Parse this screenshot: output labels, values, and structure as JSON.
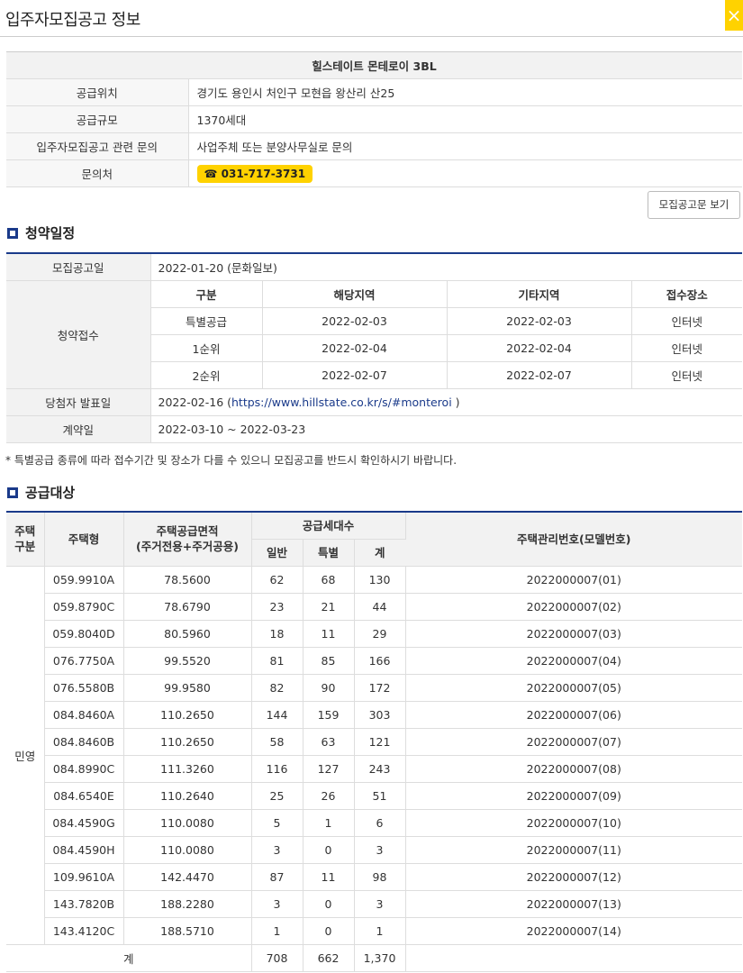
{
  "header": {
    "title": "입주자모집공고 정보",
    "close_glyph": "×"
  },
  "info": {
    "complex_name": "힐스테이트 몬테로이 3BL",
    "rows": [
      {
        "label": "공급위치",
        "value": "경기도 용인시 처인구 모현읍 왕산리 산25"
      },
      {
        "label": "공급규모",
        "value": "1370세대"
      },
      {
        "label": "입주자모집공고 관련 문의",
        "value": "사업주체 또는 분양사무실로 문의"
      }
    ],
    "contact_label": "문의처",
    "contact_phone": "☎ 031-717-3731"
  },
  "notice_button": "모집공고문 보기",
  "schedule": {
    "section_title": "청약일정",
    "announce_label": "모집공고일",
    "announce_value": "2022-01-20 (문화일보)",
    "apply_label": "청약접수",
    "apply_headers": [
      "구분",
      "해당지역",
      "기타지역",
      "접수장소"
    ],
    "apply_rows": [
      [
        "특별공급",
        "2022-02-03",
        "2022-02-03",
        "인터넷"
      ],
      [
        "1순위",
        "2022-02-04",
        "2022-02-04",
        "인터넷"
      ],
      [
        "2순위",
        "2022-02-07",
        "2022-02-07",
        "인터넷"
      ]
    ],
    "winner_label": "당첨자 발표일",
    "winner_date": "2022-02-16 (",
    "winner_url": "https://www.hillstate.co.kr/s/#monteroi",
    "winner_close": " )",
    "contract_label": "계약일",
    "contract_value": "2022-03-10 ~ 2022-03-23"
  },
  "footnote": "* 특별공급 종류에 따라 접수기간 및 장소가 다를 수 있으니 모집공고를 반드시 확인하시기 바랍니다.",
  "supply": {
    "section_title": "공급대상",
    "headers": {
      "category_line1": "주택",
      "category_line2": "구분",
      "type": "주택형",
      "area_line1": "주택공급면적",
      "area_line2": "(주거전용+주거공용)",
      "units": "공급세대수",
      "general": "일반",
      "special": "특별",
      "sum": "계",
      "model": "주택관리번호(모델번호)"
    },
    "category": "민영",
    "rows": [
      [
        "059.9910A",
        "78.5600",
        "62",
        "68",
        "130",
        "2022000007(01)"
      ],
      [
        "059.8790C",
        "78.6790",
        "23",
        "21",
        "44",
        "2022000007(02)"
      ],
      [
        "059.8040D",
        "80.5960",
        "18",
        "11",
        "29",
        "2022000007(03)"
      ],
      [
        "076.7750A",
        "99.5520",
        "81",
        "85",
        "166",
        "2022000007(04)"
      ],
      [
        "076.5580B",
        "99.9580",
        "82",
        "90",
        "172",
        "2022000007(05)"
      ],
      [
        "084.8460A",
        "110.2650",
        "144",
        "159",
        "303",
        "2022000007(06)"
      ],
      [
        "084.8460B",
        "110.2650",
        "58",
        "63",
        "121",
        "2022000007(07)"
      ],
      [
        "084.8990C",
        "111.3260",
        "116",
        "127",
        "243",
        "2022000007(08)"
      ],
      [
        "084.6540E",
        "110.2640",
        "25",
        "26",
        "51",
        "2022000007(09)"
      ],
      [
        "084.4590G",
        "110.0080",
        "5",
        "1",
        "6",
        "2022000007(10)"
      ],
      [
        "084.4590H",
        "110.0080",
        "3",
        "0",
        "3",
        "2022000007(11)"
      ],
      [
        "109.9610A",
        "142.4470",
        "87",
        "11",
        "98",
        "2022000007(12)"
      ],
      [
        "143.7820B",
        "188.2280",
        "3",
        "0",
        "3",
        "2022000007(13)"
      ],
      [
        "143.4120C",
        "188.5710",
        "1",
        "0",
        "1",
        "2022000007(14)"
      ]
    ],
    "total_label": "계",
    "total_general": "708",
    "total_special": "662",
    "total_sum": "1,370"
  }
}
